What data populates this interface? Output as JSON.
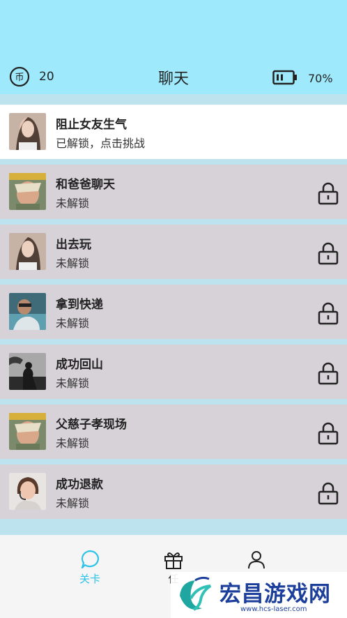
{
  "header": {
    "coins": "20",
    "title": "聊天",
    "battery": "70%"
  },
  "levels": [
    {
      "name": "阻止女友生气",
      "status": "已解锁，点击挑战",
      "locked": false,
      "avatar": "woman-portrait"
    },
    {
      "name": "和爸爸聊天",
      "status": "未解锁",
      "locked": true,
      "avatar": "old-man"
    },
    {
      "name": "出去玩",
      "status": "未解锁",
      "locked": true,
      "avatar": "woman-portrait"
    },
    {
      "name": "拿到快递",
      "status": "未解锁",
      "locked": true,
      "avatar": "man-car"
    },
    {
      "name": "成功回山",
      "status": "未解锁",
      "locked": true,
      "avatar": "silhouette-tree"
    },
    {
      "name": "父慈子孝现场",
      "status": "未解锁",
      "locked": true,
      "avatar": "old-man"
    },
    {
      "name": "成功退款",
      "status": "未解锁",
      "locked": true,
      "avatar": "operator-woman"
    }
  ],
  "nav": {
    "levels_label": "关卡",
    "tasks_label": "任",
    "profile_label": ""
  },
  "watermark": {
    "title": "宏昌游戏网",
    "url": "www.hcs-laser.com"
  },
  "colors": {
    "accent": "#2bc3e8",
    "top_band": "#9eeafc",
    "locked_row": "#d6d2d7"
  }
}
